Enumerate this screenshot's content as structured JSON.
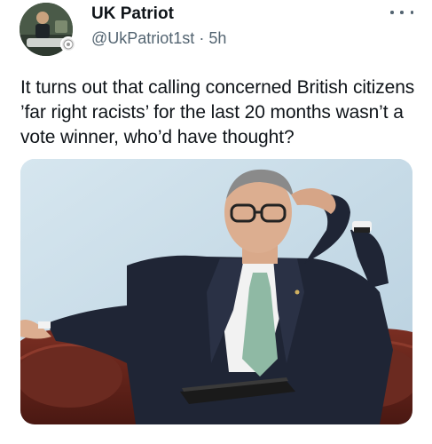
{
  "tweet": {
    "author_name": "UK Patriot",
    "handle": "@UkPatriot1st",
    "separator": " · ",
    "time": "5h",
    "text": "It turns out that calling concerned British citizens ’far right racists’ for the last 20 months wasn’t a vote winner, who’d have thought?"
  },
  "icons": {
    "more": "more-horizontal-icon"
  }
}
